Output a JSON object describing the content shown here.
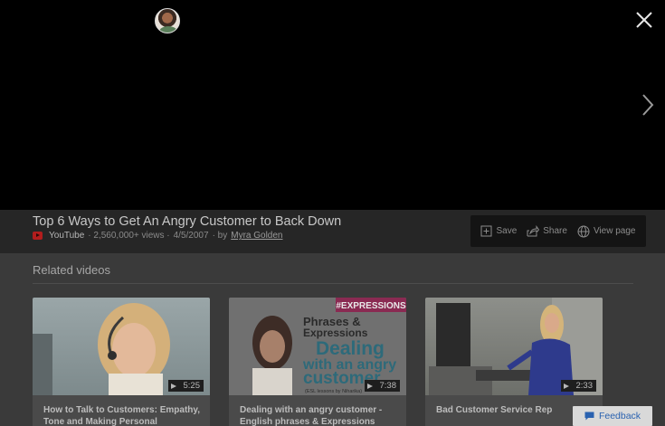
{
  "video": {
    "title": "Top 6 Ways to Get An Angry Customer to Back Down",
    "source": "YouTube",
    "views": "· 2,560,000+ views ·",
    "date": "4/5/2007",
    "by": "· by",
    "author": "Myra Golden"
  },
  "actions": {
    "save": "Save",
    "share": "Share",
    "view_page": "View page"
  },
  "related": {
    "heading": "Related videos",
    "items": [
      {
        "title": "How to Talk to Customers: Empathy, Tone and Making Personal Emotional",
        "duration": "5:25"
      },
      {
        "title": "Dealing with an angry customer - English phrases & Expressions",
        "duration": "7:38"
      },
      {
        "title": "Bad Customer Service Rep",
        "duration": "2:33"
      }
    ]
  },
  "thumb2": {
    "tag": "#EXPRESSIONS",
    "line1": "Phrases &",
    "line2": "Expressions",
    "line3": "Dealing",
    "line4": "with an angry",
    "line5": "customer",
    "footer": "(ESL lessons by Niharika)"
  },
  "feedback": "Feedback",
  "icons": {
    "close": "close-icon",
    "next": "chevron-right-icon",
    "save": "save-icon",
    "share": "share-icon",
    "view_page": "globe-icon"
  }
}
